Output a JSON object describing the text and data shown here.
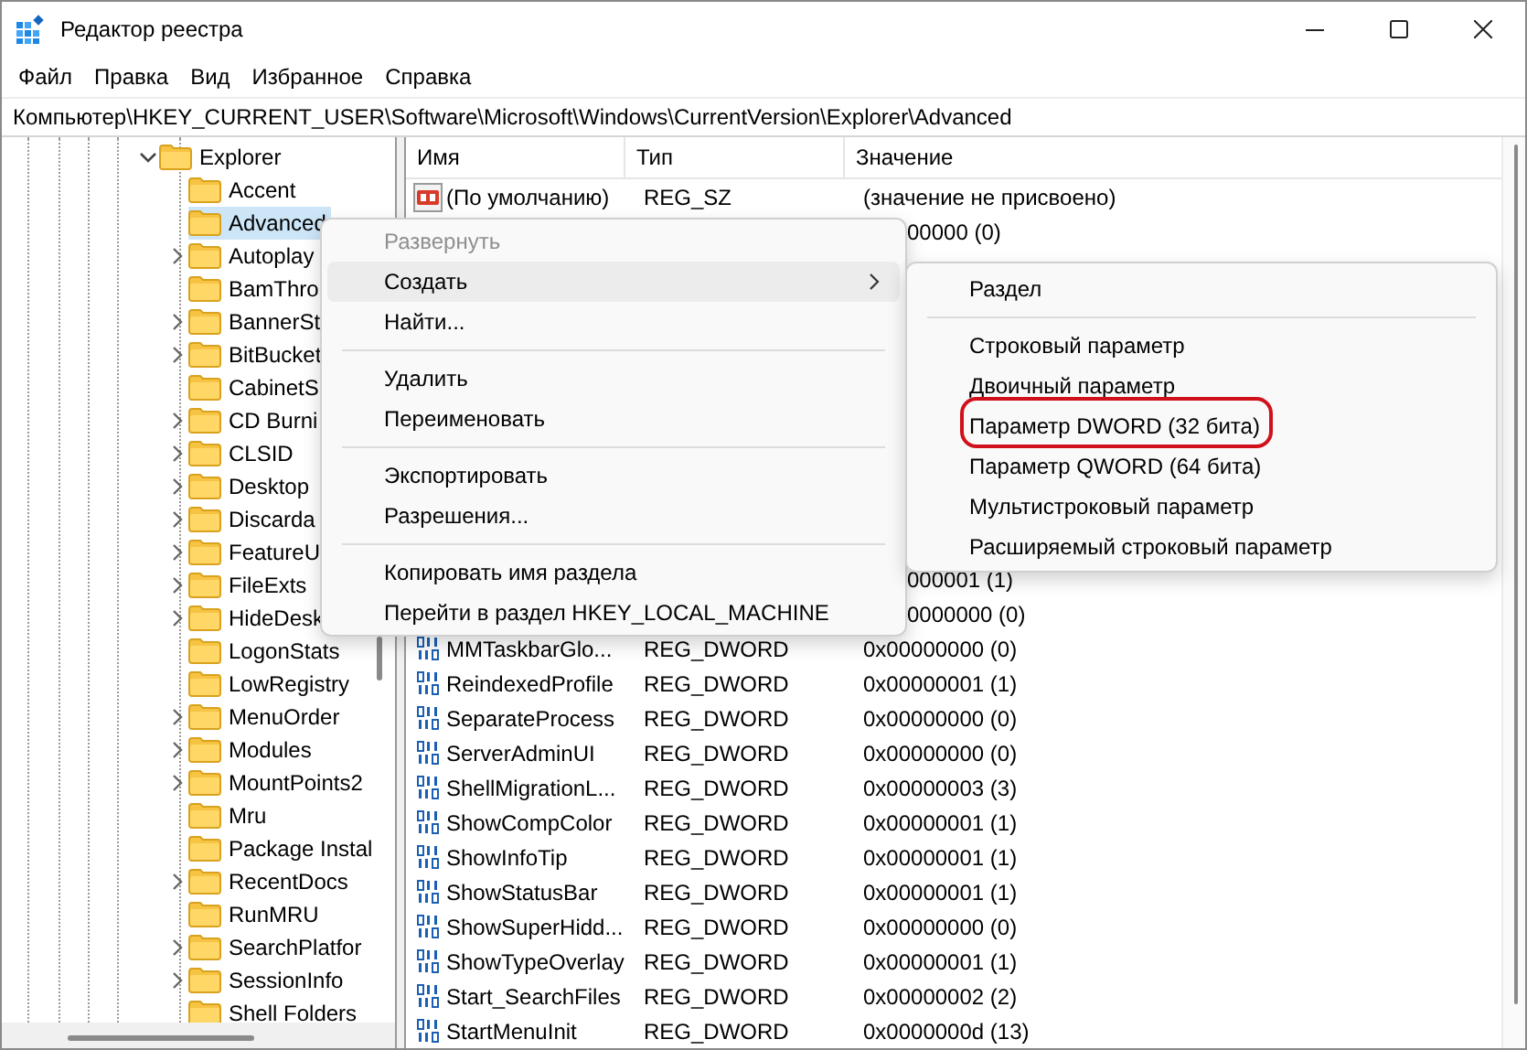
{
  "window": {
    "title": "Редактор реестра"
  },
  "menu_bar": [
    "Файл",
    "Правка",
    "Вид",
    "Избранное",
    "Справка"
  ],
  "address": "Компьютер\\HKEY_CURRENT_USER\\Software\\Microsoft\\Windows\\CurrentVersion\\Explorer\\Advanced",
  "tree": [
    {
      "label": "Explorer",
      "has_children": true,
      "expanded": true,
      "selected": false,
      "children": [
        {
          "label": "Accent",
          "has_children": false,
          "selected": false
        },
        {
          "label": "Advanced",
          "has_children": false,
          "selected": true
        },
        {
          "label": "Autoplay",
          "has_children": true,
          "selected": false
        },
        {
          "label": "BamThro",
          "has_children": false,
          "selected": false
        },
        {
          "label": "BannerSt",
          "has_children": true,
          "selected": false
        },
        {
          "label": "BitBucket",
          "has_children": true,
          "selected": false
        },
        {
          "label": "CabinetS",
          "has_children": false,
          "selected": false
        },
        {
          "label": "CD Burni",
          "has_children": true,
          "selected": false
        },
        {
          "label": "CLSID",
          "has_children": true,
          "selected": false
        },
        {
          "label": "Desktop",
          "has_children": true,
          "selected": false
        },
        {
          "label": "Discarda",
          "has_children": true,
          "selected": false
        },
        {
          "label": "FeatureU",
          "has_children": true,
          "selected": false
        },
        {
          "label": "FileExts",
          "has_children": true,
          "selected": false
        },
        {
          "label": "HideDesk",
          "has_children": true,
          "selected": false
        },
        {
          "label": "LogonStats",
          "has_children": false,
          "selected": false
        },
        {
          "label": "LowRegistry",
          "has_children": false,
          "selected": false
        },
        {
          "label": "MenuOrder",
          "has_children": true,
          "selected": false
        },
        {
          "label": "Modules",
          "has_children": true,
          "selected": false
        },
        {
          "label": "MountPoints2",
          "has_children": true,
          "selected": false
        },
        {
          "label": "Mru",
          "has_children": false,
          "selected": false
        },
        {
          "label": "Package Instal",
          "has_children": false,
          "selected": false
        },
        {
          "label": "RecentDocs",
          "has_children": true,
          "selected": false
        },
        {
          "label": "RunMRU",
          "has_children": false,
          "selected": false
        },
        {
          "label": "SearchPlatfor",
          "has_children": true,
          "selected": false
        },
        {
          "label": "SessionInfo",
          "has_children": true,
          "selected": false
        },
        {
          "label": "Shell Folders",
          "has_children": false,
          "selected": false
        }
      ]
    }
  ],
  "list": {
    "columns": [
      "Имя",
      "Тип",
      "Значение"
    ],
    "rows": [
      {
        "kind": "string",
        "name": "(По умолчанию)",
        "type": "REG_SZ",
        "value": "(значение не присвоено)"
      },
      {
        "kind": "partial",
        "value": "00000 (0)"
      },
      {
        "kind": "partial",
        "value": "000001 (1)"
      },
      {
        "kind": "partial",
        "value": "0000000 (0)"
      },
      {
        "kind": "dword",
        "name": "MMTaskbarGlo...",
        "type": "REG_DWORD",
        "value": "0x00000000 (0)"
      },
      {
        "kind": "dword",
        "name": "ReindexedProfile",
        "type": "REG_DWORD",
        "value": "0x00000001 (1)"
      },
      {
        "kind": "dword",
        "name": "SeparateProcess",
        "type": "REG_DWORD",
        "value": "0x00000000 (0)"
      },
      {
        "kind": "dword",
        "name": "ServerAdminUI",
        "type": "REG_DWORD",
        "value": "0x00000000 (0)"
      },
      {
        "kind": "dword",
        "name": "ShellMigrationL...",
        "type": "REG_DWORD",
        "value": "0x00000003 (3)"
      },
      {
        "kind": "dword",
        "name": "ShowCompColor",
        "type": "REG_DWORD",
        "value": "0x00000001 (1)"
      },
      {
        "kind": "dword",
        "name": "ShowInfoTip",
        "type": "REG_DWORD",
        "value": "0x00000001 (1)"
      },
      {
        "kind": "dword",
        "name": "ShowStatusBar",
        "type": "REG_DWORD",
        "value": "0x00000001 (1)"
      },
      {
        "kind": "dword",
        "name": "ShowSuperHidd...",
        "type": "REG_DWORD",
        "value": "0x00000000 (0)"
      },
      {
        "kind": "dword",
        "name": "ShowTypeOverlay",
        "type": "REG_DWORD",
        "value": "0x00000001 (1)"
      },
      {
        "kind": "dword",
        "name": "Start_SearchFiles",
        "type": "REG_DWORD",
        "value": "0x00000002 (2)"
      },
      {
        "kind": "dword",
        "name": "StartMenuInit",
        "type": "REG_DWORD",
        "value": "0x0000000d (13)"
      }
    ]
  },
  "context_menu": {
    "items": [
      {
        "kind": "item",
        "label": "Развернуть",
        "disabled": true,
        "selected": false,
        "submenu": false
      },
      {
        "kind": "item",
        "label": "Создать",
        "disabled": false,
        "selected": true,
        "submenu": true
      },
      {
        "kind": "item",
        "label": "Найти...",
        "disabled": false,
        "selected": false,
        "submenu": false
      },
      {
        "kind": "separator"
      },
      {
        "kind": "item",
        "label": "Удалить",
        "disabled": false,
        "selected": false,
        "submenu": false
      },
      {
        "kind": "item",
        "label": "Переименовать",
        "disabled": false,
        "selected": false,
        "submenu": false
      },
      {
        "kind": "separator"
      },
      {
        "kind": "item",
        "label": "Экспортировать",
        "disabled": false,
        "selected": false,
        "submenu": false
      },
      {
        "kind": "item",
        "label": "Разрешения...",
        "disabled": false,
        "selected": false,
        "submenu": false
      },
      {
        "kind": "separator"
      },
      {
        "kind": "item",
        "label": "Копировать имя раздела",
        "disabled": false,
        "selected": false,
        "submenu": false
      },
      {
        "kind": "item",
        "label": "Перейти в раздел HKEY_LOCAL_MACHINE",
        "disabled": false,
        "selected": false,
        "submenu": false
      }
    ]
  },
  "submenu": {
    "items": [
      {
        "kind": "item",
        "label": "Раздел",
        "circled": false
      },
      {
        "kind": "separator"
      },
      {
        "kind": "item",
        "label": "Строковый параметр",
        "circled": false
      },
      {
        "kind": "item",
        "label": "Двоичный параметр",
        "circled": false
      },
      {
        "kind": "item",
        "label": "Параметр DWORD (32 бита)",
        "circled": true
      },
      {
        "kind": "item",
        "label": "Параметр QWORD (64 бита)",
        "circled": false
      },
      {
        "kind": "item",
        "label": "Мультистроковый параметр",
        "circled": false
      },
      {
        "kind": "item",
        "label": "Расширяемый строковый параметр",
        "circled": false
      }
    ]
  }
}
